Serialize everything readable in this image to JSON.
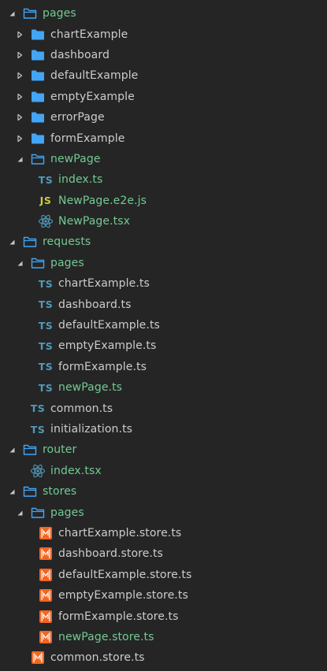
{
  "colors": {
    "background": "#252526",
    "text": "#cccccc",
    "modified_text": "#73c991",
    "folder_icon": "#42a5f5",
    "ts_icon": "#519aba",
    "js_icon": "#cbcb41",
    "react_icon": "#519aba",
    "mobx_icon": "#f26522"
  },
  "tree": [
    {
      "label": "pages",
      "kind": "folder-open",
      "depth": 0,
      "expanded": true,
      "modified": true
    },
    {
      "label": "chartExample",
      "kind": "folder",
      "depth": 1,
      "expanded": false,
      "modified": false
    },
    {
      "label": "dashboard",
      "kind": "folder",
      "depth": 1,
      "expanded": false,
      "modified": false
    },
    {
      "label": "defaultExample",
      "kind": "folder",
      "depth": 1,
      "expanded": false,
      "modified": false
    },
    {
      "label": "emptyExample",
      "kind": "folder",
      "depth": 1,
      "expanded": false,
      "modified": false
    },
    {
      "label": "errorPage",
      "kind": "folder",
      "depth": 1,
      "expanded": false,
      "modified": false
    },
    {
      "label": "formExample",
      "kind": "folder",
      "depth": 1,
      "expanded": false,
      "modified": false
    },
    {
      "label": "newPage",
      "kind": "folder-open",
      "depth": 1,
      "expanded": true,
      "modified": true
    },
    {
      "label": "index.ts",
      "kind": "ts",
      "depth": 2,
      "modified": true
    },
    {
      "label": "NewPage.e2e.js",
      "kind": "js",
      "depth": 2,
      "modified": true
    },
    {
      "label": "NewPage.tsx",
      "kind": "react",
      "depth": 2,
      "modified": true
    },
    {
      "label": "requests",
      "kind": "folder-open",
      "depth": 0,
      "expanded": true,
      "modified": true
    },
    {
      "label": "pages",
      "kind": "folder-open",
      "depth": 1,
      "expanded": true,
      "modified": true
    },
    {
      "label": "chartExample.ts",
      "kind": "ts",
      "depth": 2,
      "modified": false
    },
    {
      "label": "dashboard.ts",
      "kind": "ts",
      "depth": 2,
      "modified": false
    },
    {
      "label": "defaultExample.ts",
      "kind": "ts",
      "depth": 2,
      "modified": false
    },
    {
      "label": "emptyExample.ts",
      "kind": "ts",
      "depth": 2,
      "modified": false
    },
    {
      "label": "formExample.ts",
      "kind": "ts",
      "depth": 2,
      "modified": false
    },
    {
      "label": "newPage.ts",
      "kind": "ts",
      "depth": 2,
      "modified": true
    },
    {
      "label": "common.ts",
      "kind": "ts",
      "depth": 1,
      "modified": false
    },
    {
      "label": "initialization.ts",
      "kind": "ts",
      "depth": 1,
      "modified": false
    },
    {
      "label": "router",
      "kind": "folder-open",
      "depth": 0,
      "expanded": true,
      "modified": true
    },
    {
      "label": "index.tsx",
      "kind": "react",
      "depth": 1,
      "modified": true
    },
    {
      "label": "stores",
      "kind": "folder-open",
      "depth": 0,
      "expanded": true,
      "modified": true
    },
    {
      "label": "pages",
      "kind": "folder-open",
      "depth": 1,
      "expanded": true,
      "modified": true
    },
    {
      "label": "chartExample.store.ts",
      "kind": "mobx",
      "depth": 2,
      "modified": false
    },
    {
      "label": "dashboard.store.ts",
      "kind": "mobx",
      "depth": 2,
      "modified": false
    },
    {
      "label": "defaultExample.store.ts",
      "kind": "mobx",
      "depth": 2,
      "modified": false
    },
    {
      "label": "emptyExample.store.ts",
      "kind": "mobx",
      "depth": 2,
      "modified": false
    },
    {
      "label": "formExample.store.ts",
      "kind": "mobx",
      "depth": 2,
      "modified": false
    },
    {
      "label": "newPage.store.ts",
      "kind": "mobx",
      "depth": 2,
      "modified": true
    },
    {
      "label": "common.store.ts",
      "kind": "mobx",
      "depth": 1,
      "modified": false
    }
  ]
}
